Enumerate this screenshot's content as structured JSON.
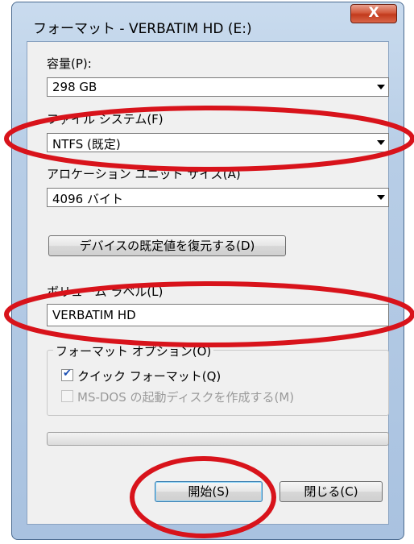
{
  "window": {
    "title": "フォーマット - VERBATIM HD (E:)",
    "close_label": "X"
  },
  "capacity": {
    "label": "容量(P):",
    "value": "298 GB"
  },
  "filesystem": {
    "label": "ファイル システム(F)",
    "value": "NTFS (既定)"
  },
  "allocation": {
    "label": "アロケーション ユニット サイズ(A)",
    "value": "4096 バイト"
  },
  "restore_defaults_label": "デバイスの既定値を復元する(D)",
  "volume": {
    "label": "ボリューム ラベル(L)",
    "value": "VERBATIM HD"
  },
  "options": {
    "title": "フォーマット オプション(O)",
    "quick": {
      "label": "クイック フォーマット(Q)",
      "checked": true
    },
    "msdos": {
      "label": "MS-DOS の起動ディスクを作成する(M)",
      "checked": false
    }
  },
  "progress": {
    "value": 0
  },
  "start_label": "開始(S)",
  "close_button_label": "閉じる(C)",
  "colors": {
    "highlight_ellipse": "#d8131b",
    "title_bar": "#b7cde6",
    "close_button": "#c23a1c"
  }
}
